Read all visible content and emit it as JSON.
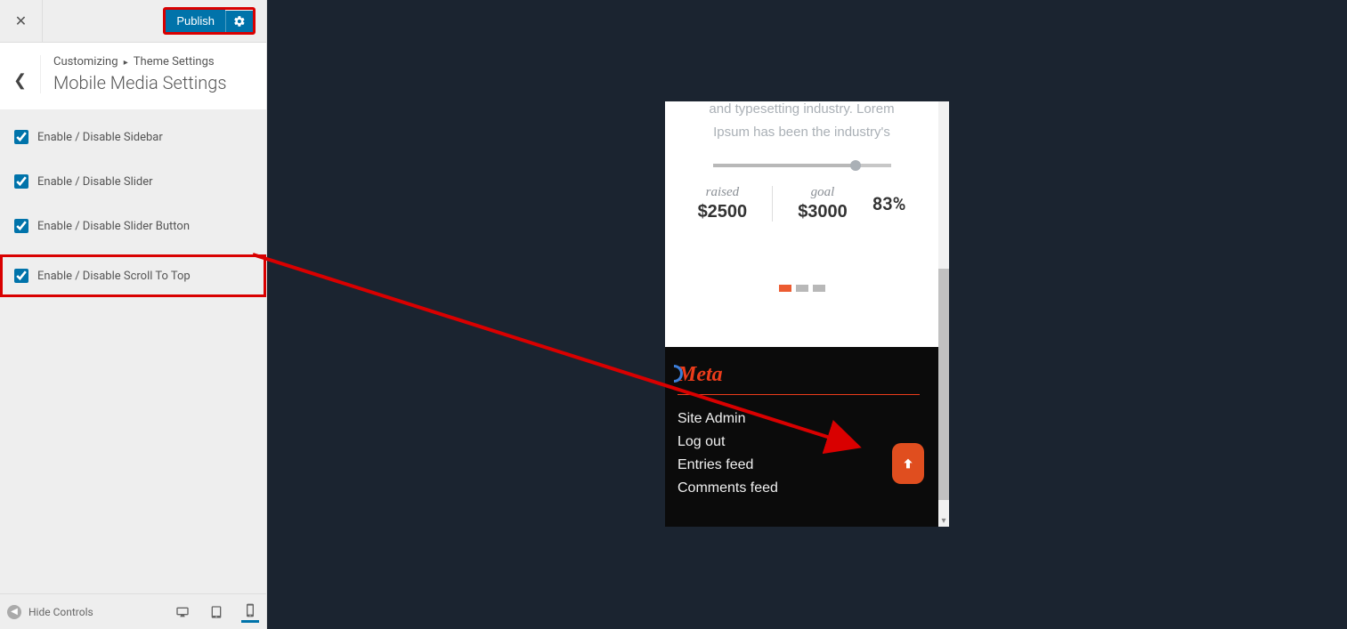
{
  "topbar": {
    "publish_label": "Publish"
  },
  "header": {
    "crumb1": "Customizing",
    "crumb2": "Theme Settings",
    "section_title": "Mobile Media Settings"
  },
  "options": [
    {
      "label": "Enable / Disable Sidebar",
      "checked": true
    },
    {
      "label": "Enable / Disable Slider",
      "checked": true
    },
    {
      "label": "Enable / Disable Slider Button",
      "checked": true
    },
    {
      "label": "Enable / Disable Scroll To Top",
      "checked": true
    }
  ],
  "footer": {
    "hide_controls": "Hide Controls"
  },
  "preview": {
    "lorem_line1": "and typesetting industry. Lorem",
    "lorem_line2": "Ipsum has been the industry's",
    "stats": {
      "raised_label": "raised",
      "raised_value": "$2500",
      "goal_label": "goal",
      "goal_value": "$3000",
      "percent": "83%"
    },
    "meta": {
      "title": "Meta",
      "links": [
        "Site Admin",
        "Log out",
        "Entries feed",
        "Comments feed"
      ]
    }
  }
}
